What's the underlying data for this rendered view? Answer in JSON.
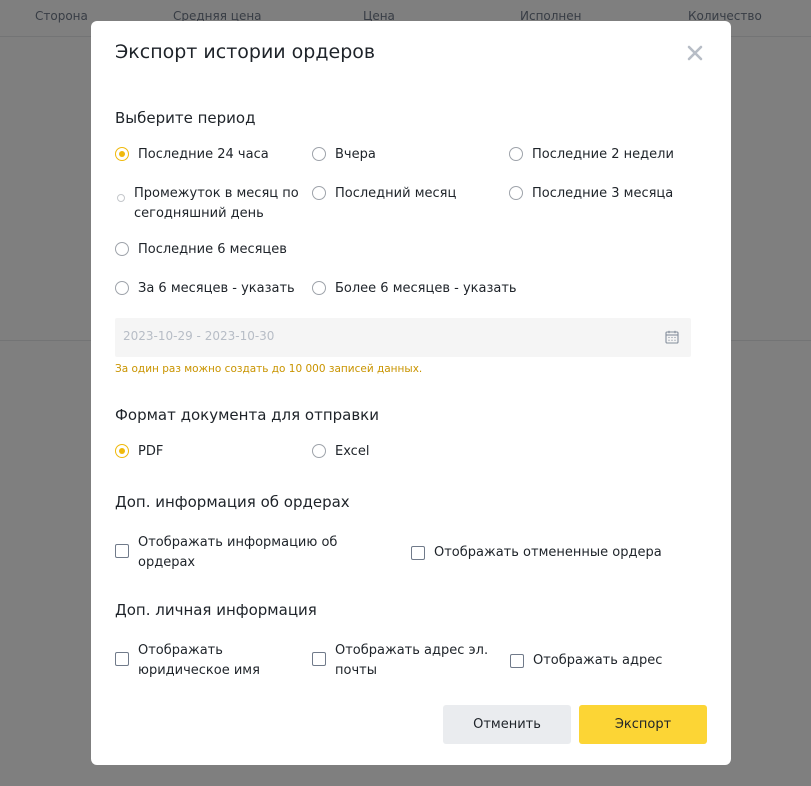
{
  "background": {
    "columns": [
      "Сторона",
      "Средняя цена",
      "Цена",
      "Исполнен",
      "Количество"
    ]
  },
  "modal": {
    "title": "Экспорт истории ордеров",
    "period": {
      "title": "Выберите период",
      "options": [
        {
          "label": "Последние 24 часа",
          "selected": true
        },
        {
          "label": "Вчера",
          "selected": false
        },
        {
          "label": "Последние 2 недели",
          "selected": false
        },
        {
          "label": "Промежуток в месяц по сегодняшний день",
          "selected": false
        },
        {
          "label": "Последний месяц",
          "selected": false
        },
        {
          "label": "Последние 3 месяца",
          "selected": false
        },
        {
          "label": "Последние 6 месяцев",
          "selected": false
        },
        {
          "label": "За 6 месяцев - указать",
          "selected": false
        },
        {
          "label": "Более 6 месяцев - указать",
          "selected": false
        }
      ],
      "date_range_placeholder": "2023-10-29 - 2023-10-30",
      "hint": "За один раз можно создать до 10 000 записей данных."
    },
    "format": {
      "title": "Формат документа для отправки",
      "options": [
        {
          "label": "PDF",
          "selected": true
        },
        {
          "label": "Excel",
          "selected": false
        }
      ]
    },
    "order_info": {
      "title": "Доп. информация об ордерах",
      "options": [
        {
          "label": "Отображать информацию об ордерах",
          "checked": false
        },
        {
          "label": "Отображать отмененные ордера",
          "checked": false
        }
      ]
    },
    "personal_info": {
      "title": "Доп. личная информация",
      "options": [
        {
          "label": "Отображать юридическое имя",
          "checked": false
        },
        {
          "label": "Отображать адрес эл. почты",
          "checked": false
        },
        {
          "label": "Отображать адрес",
          "checked": false
        }
      ]
    },
    "buttons": {
      "cancel": "Отменить",
      "export": "Экспорт"
    }
  },
  "colors": {
    "accent": "#f0b90b",
    "export_button": "#fcd535",
    "cancel_button": "#eaecef",
    "hint_text": "#c99400"
  }
}
